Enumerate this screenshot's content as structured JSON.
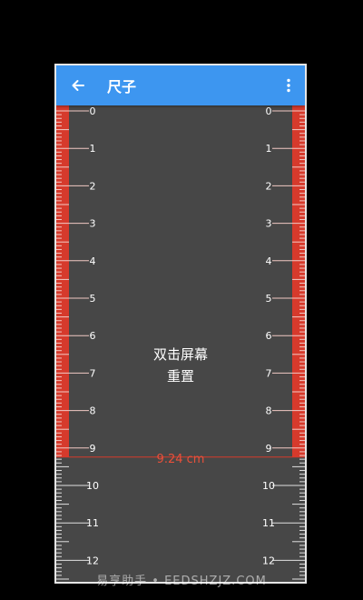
{
  "appbar": {
    "title": "尺子",
    "back_icon": "arrow-left-icon",
    "menu_icon": "more-vert-icon",
    "color": "#3d96f0"
  },
  "ruler": {
    "labels": [
      "0",
      "1",
      "2",
      "3",
      "4",
      "5",
      "6",
      "7",
      "8",
      "9",
      "10",
      "11",
      "12"
    ],
    "measured_value_cm": 9.24,
    "highlight_color": "#d63a2c",
    "background": "#474747"
  },
  "hint": {
    "line1": "双击屏幕",
    "line2": "重置"
  },
  "measurement": {
    "text": "9.24 cm"
  },
  "watermark": {
    "text": "易享助手 • EEDSHZJZ.COM"
  }
}
